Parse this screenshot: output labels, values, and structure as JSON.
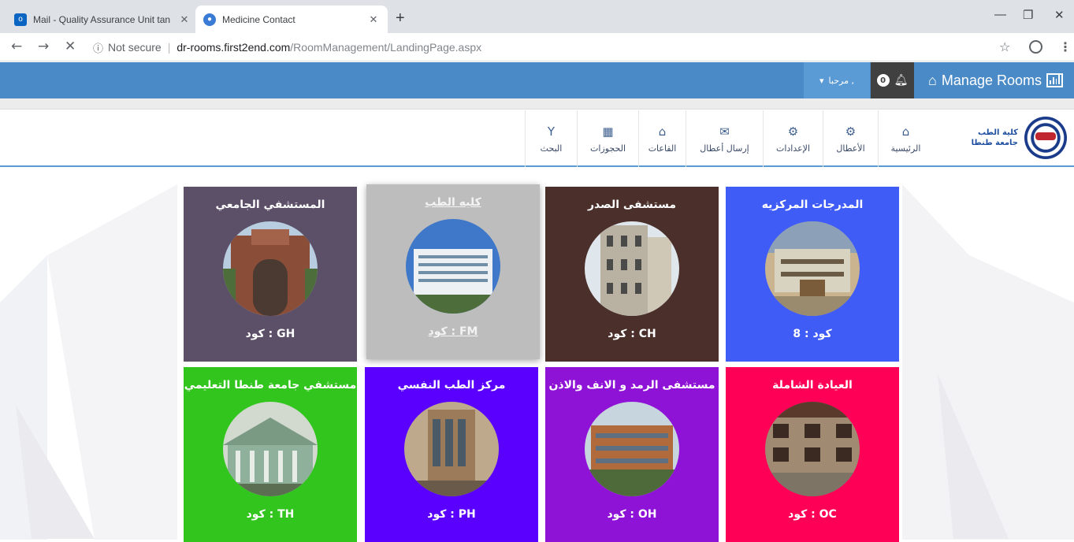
{
  "browser": {
    "tabs": [
      {
        "title": "Mail - Quality Assurance Unit tan",
        "active": false,
        "icon": "outlook-icon"
      },
      {
        "title": "Medicine Contact",
        "active": true,
        "icon": "site-icon"
      }
    ],
    "new_tab": "+",
    "address": {
      "security": "Not secure",
      "host": "dr-rooms.first2end.com",
      "path": "/RoomManagement/LandingPage.aspx"
    }
  },
  "header": {
    "brand": "Manage Rooms",
    "notification_count": "0",
    "user_label": "مرحبا ,"
  },
  "nav": {
    "items": [
      {
        "key": "home",
        "label": "الرئيسية",
        "icon": "home-icon"
      },
      {
        "key": "holidays",
        "label": "الأعطال",
        "icon": "gear-icon"
      },
      {
        "key": "settings",
        "label": "الإعدادات",
        "icon": "cogs-icon"
      },
      {
        "key": "send",
        "label": "إرسال أعطال",
        "icon": "envelope-icon"
      },
      {
        "key": "halls",
        "label": "القاعات",
        "icon": "home-icon"
      },
      {
        "key": "bookings",
        "label": "الحجوزات",
        "icon": "calendar-icon"
      },
      {
        "key": "search",
        "label": "البحث",
        "icon": "filter-icon"
      }
    ],
    "logo_text_1": "كلية الطب",
    "logo_text_2": "جامعة طنطا"
  },
  "cards": [
    {
      "title": "المدرجات المركزيه",
      "code": "كود : 8",
      "color": "#3f5cf7"
    },
    {
      "title": "مستشفى الصدر",
      "code": "كود : CH",
      "color": "#4a2f2b"
    },
    {
      "title": "كليه الطب",
      "code": "كود : FM",
      "color": "#bdbdbd"
    },
    {
      "title": "المستشفي الجامعي",
      "code": "كود : GH",
      "color": "#5c4f68"
    },
    {
      "title": "العيادة الشاملة",
      "code": "كود : OC",
      "color": "#ff0057"
    },
    {
      "title": "مستشفى الرمد و الانف والاذن",
      "code": "كود : OH",
      "color": "#8e13d6"
    },
    {
      "title": "مركز الطب النفسي",
      "code": "كود : PH",
      "color": "#5a00ff"
    },
    {
      "title": "مستشفي جامعة طنطا التعليمي",
      "code": "كود : TH",
      "color": "#32c51e"
    }
  ]
}
